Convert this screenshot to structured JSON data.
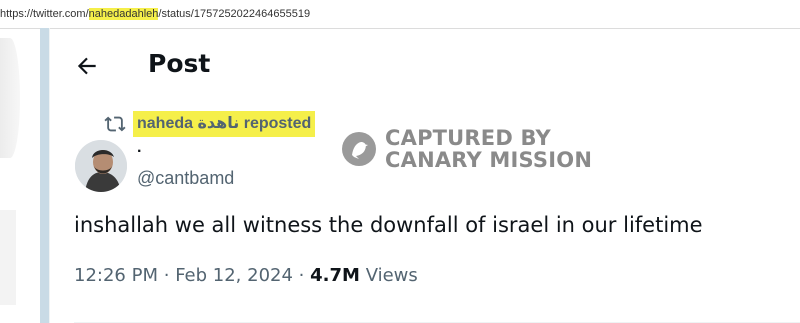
{
  "browser": {
    "url_prefix": "https://twitter.com/",
    "url_user": "nahedadahleh",
    "url_suffix": "/status/1757252022464655519"
  },
  "header": {
    "title": "Post",
    "back_icon": "arrow-left-icon"
  },
  "repost": {
    "icon": "repost-icon",
    "label": "naheda ناهدة reposted",
    "highlight_color": "#f5ef4a"
  },
  "author": {
    "display_name": "·",
    "handle": "@cantbamd"
  },
  "watermark": {
    "line1": "CAPTURED BY",
    "line2": "CANARY MISSION",
    "icon": "canary-bird-icon"
  },
  "post": {
    "text": "inshallah we all witness the downfall of israel in our lifetime",
    "time": "12:26 PM",
    "date": "Feb 12, 2024",
    "sep": "·",
    "views_count": "4.7M",
    "views_label": "Views"
  },
  "colors": {
    "text_primary": "#0f1419",
    "text_secondary": "#536471",
    "highlight": "#f5ef4a",
    "sidebar_bar": "#c9dbe6"
  }
}
